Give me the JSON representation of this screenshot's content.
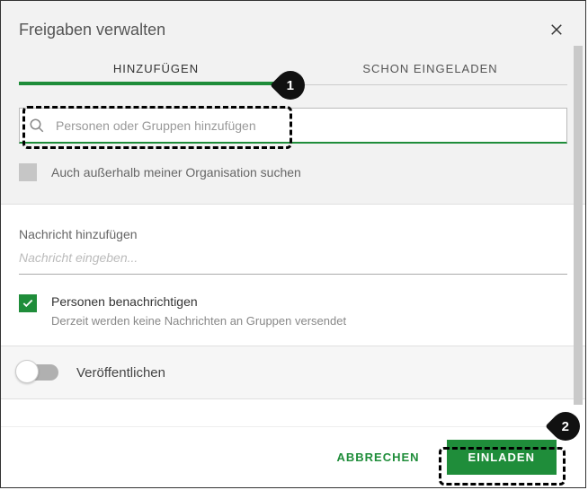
{
  "header": {
    "title": "Freigaben verwalten"
  },
  "tabs": {
    "add": "HINZUFÜGEN",
    "invited": "SCHON EINGELADEN"
  },
  "search": {
    "placeholder": "Personen oder Gruppen hinzufügen",
    "outside_org_label": "Auch außerhalb meiner Organisation suchen"
  },
  "message": {
    "label": "Nachricht hinzufügen",
    "placeholder": "Nachricht eingeben...",
    "notify_label": "Personen benachrichtigen",
    "notify_sub": "Derzeit werden keine Nachrichten an Gruppen versendet"
  },
  "publish": {
    "label": "Veröffentlichen"
  },
  "footer": {
    "cancel": "ABBRECHEN",
    "invite": "EINLADEN"
  },
  "annotations": {
    "marker1": "1",
    "marker2": "2"
  }
}
